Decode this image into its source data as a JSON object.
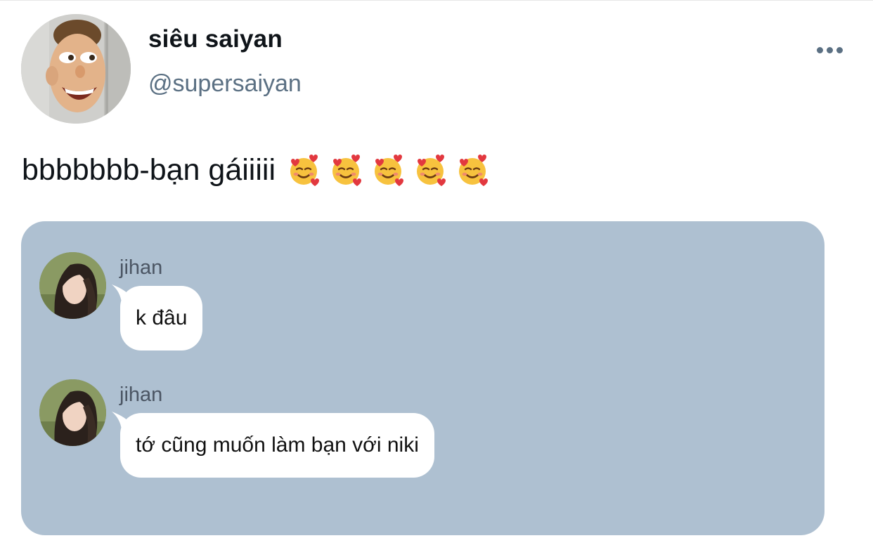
{
  "author": {
    "display_name": "siêu saiyan",
    "handle": "@supersaiyan",
    "avatar_icon": "cartoon-face-avatar"
  },
  "header": {
    "more_icon": "more-horizontal-icon"
  },
  "tweet": {
    "text": "bbbbbbb-bạn gáiiiii",
    "emojis": [
      "🥰",
      "🥰",
      "🥰",
      "🥰",
      "🥰"
    ]
  },
  "media": {
    "background_color": "#aec0d1",
    "messages": [
      {
        "sender": "jihan",
        "text": "k đâu",
        "avatar_icon": "profile-photo-avatar"
      },
      {
        "sender": "jihan",
        "text": "tớ cũng muốn làm bạn với niki",
        "avatar_icon": "profile-photo-avatar"
      }
    ]
  }
}
